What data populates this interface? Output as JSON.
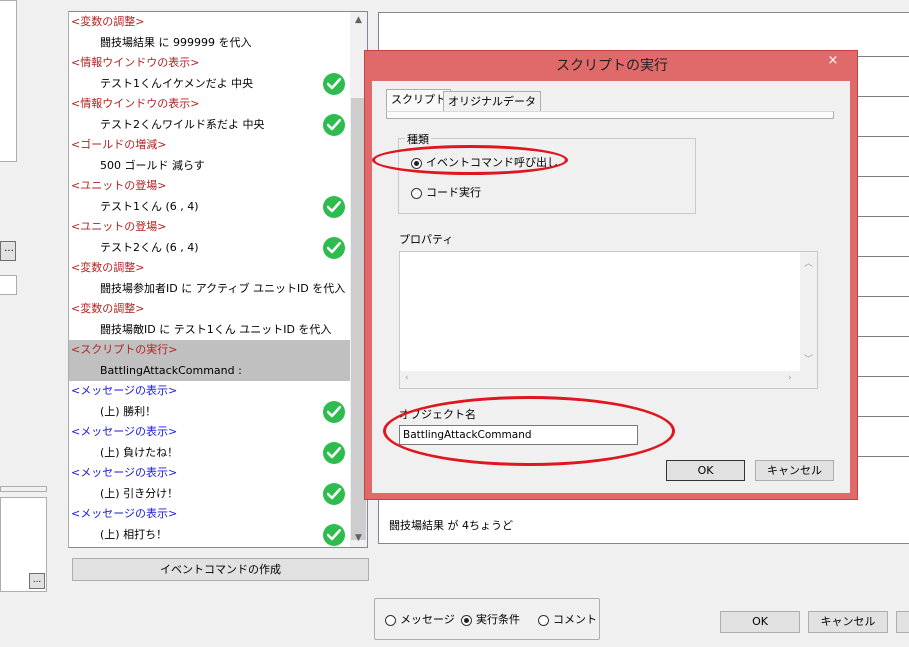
{
  "left_panel": {
    "dots_label": "...",
    "dots_label_2": "..."
  },
  "event_list": [
    {
      "text": "<変数の調整>",
      "kind": "head",
      "color": "red"
    },
    {
      "text": "闘技場結果 に 999999 を代入",
      "kind": "body",
      "check": false
    },
    {
      "text": "<情報ウインドウの表示>",
      "kind": "head",
      "color": "red"
    },
    {
      "text": "テスト1くんイケメンだよ 中央",
      "kind": "body",
      "check": true
    },
    {
      "text": "<情報ウインドウの表示>",
      "kind": "head",
      "color": "red"
    },
    {
      "text": "テスト2くんワイルド系だよ 中央",
      "kind": "body",
      "check": true
    },
    {
      "text": "<ゴールドの増減>",
      "kind": "head",
      "color": "red"
    },
    {
      "text": "500 ゴールド 減らす",
      "kind": "body",
      "check": false
    },
    {
      "text": "<ユニットの登場>",
      "kind": "head",
      "color": "red"
    },
    {
      "text": "テスト1くん (6 , 4)",
      "kind": "body",
      "check": true
    },
    {
      "text": "<ユニットの登場>",
      "kind": "head",
      "color": "red"
    },
    {
      "text": "テスト2くん (6 , 4)",
      "kind": "body",
      "check": true
    },
    {
      "text": "<変数の調整>",
      "kind": "head",
      "color": "red"
    },
    {
      "text": "闘技場参加者ID に アクティブ ユニットID を代入",
      "kind": "body",
      "check": false
    },
    {
      "text": "<変数の調整>",
      "kind": "head",
      "color": "red"
    },
    {
      "text": "闘技場敵ID に テスト1くん ユニットID を代入",
      "kind": "body",
      "check": false
    },
    {
      "text": "<スクリプトの実行>",
      "kind": "head",
      "color": "red",
      "selected": true
    },
    {
      "text": "BattlingAttackCommand :",
      "kind": "body",
      "check": false,
      "selected": true
    },
    {
      "text": "<メッセージの表示>",
      "kind": "head",
      "color": "blue"
    },
    {
      "text": "(上) 勝利！",
      "kind": "body",
      "check": true
    },
    {
      "text": "<メッセージの表示>",
      "kind": "head",
      "color": "blue"
    },
    {
      "text": "(上) 負けたね！",
      "kind": "body",
      "check": true
    },
    {
      "text": "<メッセージの表示>",
      "kind": "head",
      "color": "blue"
    },
    {
      "text": "(上) 引き分け！",
      "kind": "body",
      "check": true
    },
    {
      "text": "<メッセージの表示>",
      "kind": "head",
      "color": "blue"
    },
    {
      "text": "(上) 相打ち！",
      "kind": "body",
      "check": true
    }
  ],
  "create_button": "イベントコマンドの作成",
  "right_panel": {
    "status_text": "闘技場結果 が 4ちょうど"
  },
  "mode_radios": [
    {
      "label": "メッセージ",
      "checked": false
    },
    {
      "label": "実行条件",
      "checked": true
    },
    {
      "label": "コメント",
      "checked": false
    }
  ],
  "main_buttons": {
    "ok": "OK",
    "cancel": "キャンセル"
  },
  "dialog": {
    "title": "スクリプトの実行",
    "close": "×",
    "tabs": [
      "スクリプト",
      "オリジナルデータ"
    ],
    "group_label": "種類",
    "options": [
      {
        "label": "イベントコマンド呼び出し",
        "checked": true
      },
      {
        "label": "コード実行",
        "checked": false
      }
    ],
    "property_label": "プロパティ",
    "object_name_label": "オブジェクト名",
    "object_name_value": "BattlingAttackCommand",
    "ok": "OK",
    "cancel": "キャンセル"
  },
  "colors": {
    "accent_red": "#e06a6a",
    "annotation": "#e0151d",
    "check_green": "#2dbd4e",
    "head_red": "#b22222",
    "head_blue": "#1a1adc"
  }
}
